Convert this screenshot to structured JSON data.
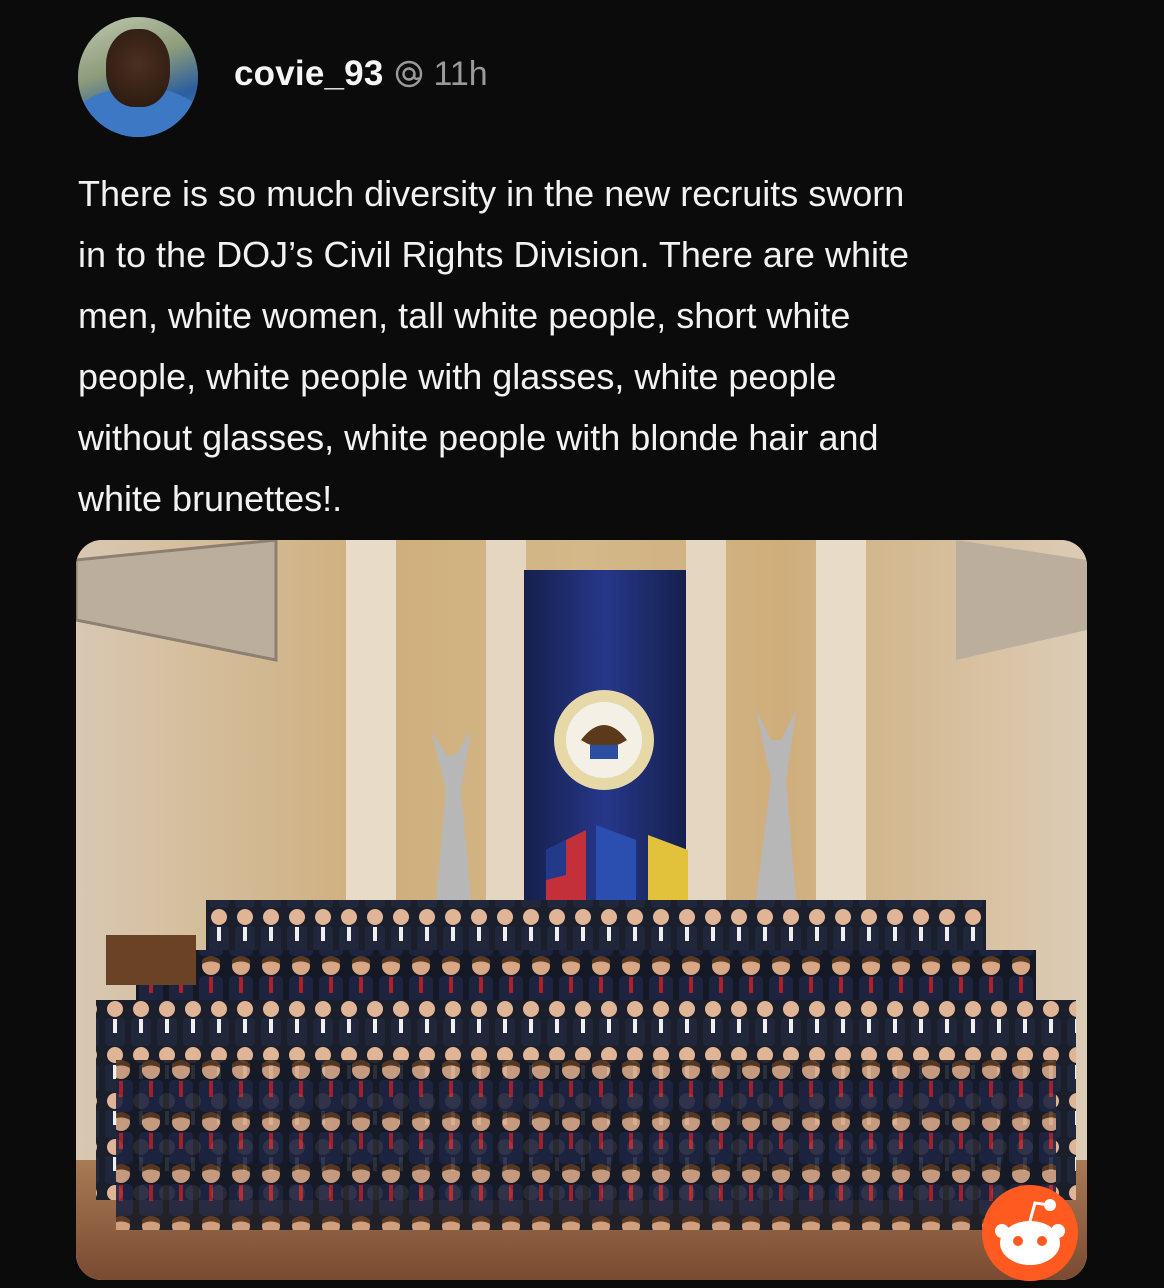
{
  "post": {
    "author": {
      "username": "covie_93",
      "avatar_icon": "avatar-photo",
      "timestamp": "11h",
      "badge_icon": "threads-icon"
    },
    "text": "There is so much diversity in the new recruits sworn\nin to the DOJ’s Civil Rights Division. There are white\nmen, white women, tall white people, short white\npeople, white people with glasses, white people\nwithout glasses, white people with blonde hair and\nwhite brunettes!.",
    "image": {
      "seal_text": "DEPARTMENT OF JUSTICE",
      "watermark_icon": "reddit-snoo-icon"
    }
  },
  "colors": {
    "background": "#0b0b0c",
    "text": "#f2f2f2",
    "muted": "#9a9a9a",
    "drape": "#1d2c66",
    "reddit": "#ff5a1f"
  }
}
